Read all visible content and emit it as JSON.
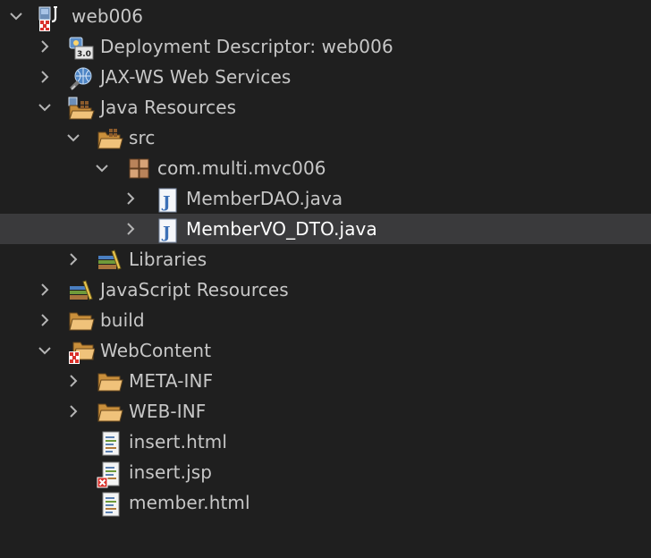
{
  "tree": {
    "items": [
      {
        "label": "web006",
        "icon": "web-project-icon",
        "expanded": true,
        "depth": 0
      },
      {
        "label": "Deployment Descriptor: web006",
        "icon": "deployment-descriptor-icon",
        "expanded": false,
        "depth": 1
      },
      {
        "label": "JAX-WS Web Services",
        "icon": "web-services-icon",
        "expanded": false,
        "depth": 1
      },
      {
        "label": "Java Resources",
        "icon": "java-resources-folder-icon",
        "expanded": true,
        "depth": 1
      },
      {
        "label": "src",
        "icon": "source-folder-icon",
        "expanded": true,
        "depth": 2
      },
      {
        "label": "com.multi.mvc006",
        "icon": "package-icon",
        "expanded": true,
        "depth": 3
      },
      {
        "label": "MemberDAO.java",
        "icon": "java-file-icon",
        "expanded": false,
        "depth": 4
      },
      {
        "label": "MemberVO_DTO.java",
        "icon": "java-file-icon",
        "expanded": false,
        "depth": 4,
        "selected": true
      },
      {
        "label": "Libraries",
        "icon": "libraries-icon",
        "expanded": false,
        "depth": 2
      },
      {
        "label": "JavaScript Resources",
        "icon": "javascript-resources-icon",
        "expanded": false,
        "depth": 1
      },
      {
        "label": "build",
        "icon": "folder-icon",
        "expanded": false,
        "depth": 1
      },
      {
        "label": "WebContent",
        "icon": "web-content-folder-icon",
        "expanded": true,
        "depth": 1
      },
      {
        "label": "META-INF",
        "icon": "folder-icon",
        "expanded": false,
        "depth": 2
      },
      {
        "label": "WEB-INF",
        "icon": "folder-icon",
        "expanded": false,
        "depth": 2
      },
      {
        "label": "insert.html",
        "icon": "html-file-icon",
        "depth": 2
      },
      {
        "label": "insert.jsp",
        "icon": "jsp-file-error-icon",
        "depth": 2
      },
      {
        "label": "member.html",
        "icon": "html-file-icon",
        "depth": 2
      }
    ]
  },
  "colors": {
    "background": "#1f1f1f",
    "selection": "#3a3a3c",
    "text": "#c7c7c7",
    "selected_text": "#ffffff",
    "folder": "#f0c27a",
    "java_blue": "#3b6fb6",
    "error_red": "#d9312b"
  }
}
